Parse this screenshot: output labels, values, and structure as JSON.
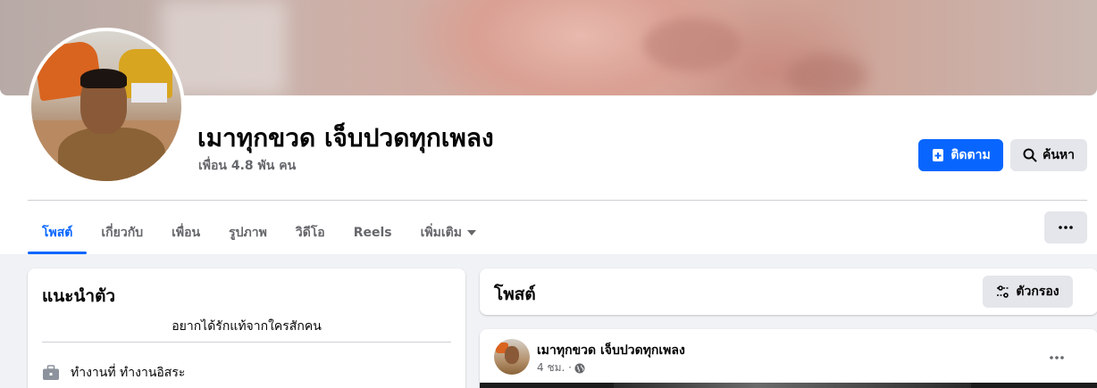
{
  "profile": {
    "name": "เมาทุกขวด เจ็บปวดทุกเพลง",
    "friends": "เพื่อน 4.8 พัน คน"
  },
  "actions": {
    "follow_label": "ติดตาม",
    "search_label": "ค้นหา"
  },
  "tabs": [
    {
      "label": "โพสต์",
      "active": true
    },
    {
      "label": "เกี่ยวกับ",
      "active": false
    },
    {
      "label": "เพื่อน",
      "active": false
    },
    {
      "label": "รูปภาพ",
      "active": false
    },
    {
      "label": "วิดีโอ",
      "active": false
    },
    {
      "label": "Reels",
      "active": false
    },
    {
      "label": "เพิ่มเติม",
      "active": false
    }
  ],
  "intro": {
    "title": "แนะนำตัว",
    "bio": "อยากได้รักแท้จากใครสักคน",
    "work": "ทำงานที่ ทำงานอิสระ"
  },
  "posts": {
    "title": "โพสต์",
    "filter_label": "ตัวกรอง",
    "items": [
      {
        "author": "เมาทุกขวด เจ็บปวดทุกเพลง",
        "time": "4 ชม. ·"
      }
    ]
  },
  "colors": {
    "accent": "#0866ff",
    "secondary_button": "#e4e6eb",
    "page_bg": "#f0f2f5",
    "muted_text": "#65676b"
  },
  "icons": {
    "follow": "add-follow-icon",
    "search": "search-icon",
    "dropdown": "caret-down-icon",
    "more": "more-horizontal-icon",
    "filter": "filter-sliders-icon",
    "work": "briefcase-icon",
    "privacy": "globe-icon"
  }
}
